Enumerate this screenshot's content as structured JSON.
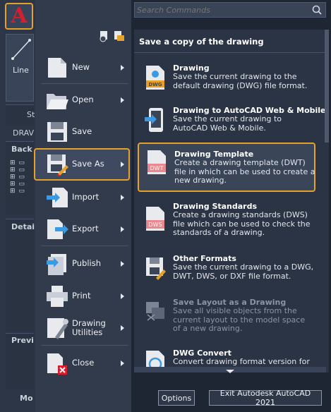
{
  "background": {
    "line_tool": "Line",
    "side_labels": [
      "St",
      "DRAV",
      "Back",
      "Detai",
      "Previ",
      "Mo"
    ]
  },
  "search": {
    "placeholder": "Search Commands"
  },
  "menu": [
    {
      "label": "New",
      "icon": "new-document-icon",
      "has_arrow": true
    },
    {
      "label": "Open",
      "icon": "open-folder-icon",
      "has_arrow": true
    },
    {
      "label": "Save",
      "icon": "floppy-disk-icon",
      "has_arrow": false
    },
    {
      "label": "Save As",
      "icon": "save-as-icon",
      "has_arrow": true,
      "active": true
    },
    {
      "label": "Import",
      "icon": "import-icon",
      "has_arrow": true
    },
    {
      "label": "Export",
      "icon": "export-icon",
      "has_arrow": true
    },
    {
      "label": "Publish",
      "icon": "publish-icon",
      "has_arrow": true
    },
    {
      "label": "Print",
      "icon": "printer-icon",
      "has_arrow": true
    },
    {
      "label": "Drawing Utilities",
      "icon": "drawing-utilities-icon",
      "has_arrow": true
    },
    {
      "label": "Close",
      "icon": "close-document-icon",
      "has_arrow": true
    }
  ],
  "panel": {
    "title": "Save a copy of the drawing",
    "options": [
      {
        "title": "Drawing",
        "desc": "Save the current drawing to the default drawing (DWG) file format.",
        "badge": "DWG",
        "icon": "dwg-file-icon"
      },
      {
        "title": "Drawing to AutoCAD Web & Mobile",
        "desc": "Save the current drawing to AutoCAD Web & Mobile.",
        "icon": "web-mobile-icon"
      },
      {
        "title": "Drawing Template",
        "desc": "Create a drawing template (DWT) file in which can be used to create a new drawing.",
        "badge": "DWT",
        "icon": "dwt-file-icon",
        "highlight": true
      },
      {
        "title": "Drawing Standards",
        "desc": "Create a drawing standards (DWS) file which can be used to check the standards of a drawing.",
        "badge": "DWS",
        "icon": "dws-file-icon"
      },
      {
        "title": "Other Formats",
        "desc": "Save the current drawing to a DWG, DWT, DWS, or DXF file format.",
        "icon": "other-formats-icon"
      },
      {
        "title": "Save Layout as a Drawing",
        "desc": "Save all visible objects from the current layout to the model space of a new drawing.",
        "icon": "save-layout-icon",
        "dim": true
      },
      {
        "title": "DWG Convert",
        "desc": "Convert drawing format version for",
        "icon": "dwg-convert-icon"
      }
    ]
  },
  "buttons": {
    "options": "Options",
    "exit": "Exit Autodesk AutoCAD 2021"
  },
  "colors": {
    "accent": "#e5a12a",
    "brand_red": "#d4202e"
  }
}
